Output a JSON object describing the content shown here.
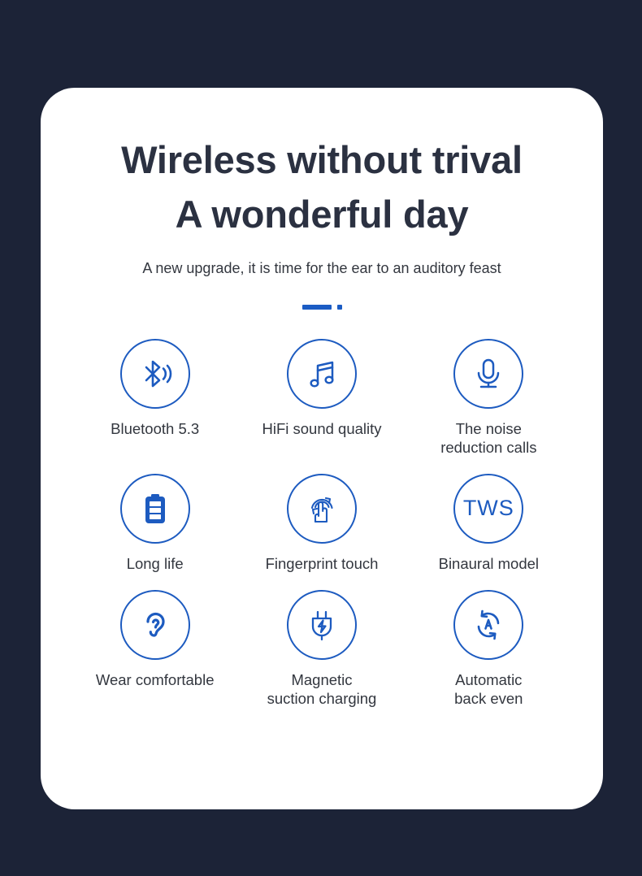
{
  "background_color": "#1c2337",
  "card_color": "#ffffff",
  "accent_color": "#1b5cc4",
  "text_color": "#33373f",
  "heading": {
    "line1": "Wireless without trival",
    "line2": "A wonderful day"
  },
  "subtitle": "A new upgrade, it is time for the ear to an auditory feast",
  "features": [
    {
      "icon": "bluetooth-icon",
      "label": "Bluetooth 5.3"
    },
    {
      "icon": "music-note-icon",
      "label": "HiFi sound quality"
    },
    {
      "icon": "microphone-icon",
      "label": "The noise\nreduction calls"
    },
    {
      "icon": "battery-icon",
      "label": "Long life"
    },
    {
      "icon": "fingerprint-touch-icon",
      "label": "Fingerprint touch"
    },
    {
      "icon": "tws-text-icon",
      "label": "Binaural model",
      "icon_text": "TWS"
    },
    {
      "icon": "ear-icon",
      "label": "Wear comfortable"
    },
    {
      "icon": "power-plug-charging-icon",
      "label": "Magnetic\nsuction charging"
    },
    {
      "icon": "auto-sync-icon",
      "label": "Automatic\nback even"
    }
  ]
}
